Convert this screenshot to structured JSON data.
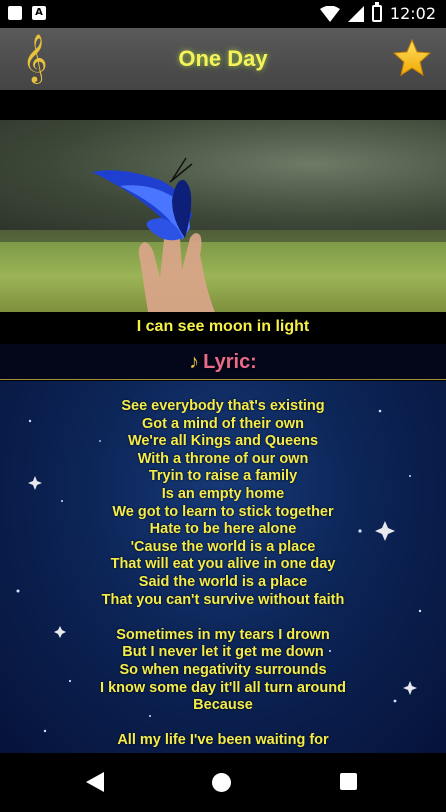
{
  "status_bar": {
    "time": "12:02",
    "left_icons": [
      "sd-card-icon",
      "notification-a-icon"
    ],
    "right_icons": [
      "wifi-icon",
      "signal-icon",
      "battery-icon"
    ]
  },
  "app_bar": {
    "title": "One Day",
    "left_icon": "treble-clef-icon",
    "right_icon": "favorite-star-icon",
    "title_color": "#f6f25a",
    "icon_color": "#e8c23a"
  },
  "video": {
    "caption": "I can see moon in light"
  },
  "lyric_section": {
    "label": "Lyric:",
    "icon": "music-note-icon",
    "label_color": "#e96a8b",
    "text_color": "#f4ec4c",
    "lines": [
      "See everybody that's existing",
      "Got a mind of their own",
      "We're all Kings and Queens",
      "With a throne of our own",
      "Tryin to raise a family",
      "Is an empty home",
      "We got to learn to stick together",
      "Hate to be here alone",
      "'Cause the world is a place",
      "That will eat you alive in one day",
      "Said the world is a place",
      "That you can't survive without faith",
      "",
      "Sometimes in my tears I drown",
      "But I never let it get me down",
      "So when negativity surrounds",
      "I know some day it'll all turn around",
      "Because",
      "",
      "All my life I've been waiting for"
    ]
  },
  "nav_bar": {
    "buttons": [
      "back-icon",
      "home-icon",
      "recent-apps-icon"
    ]
  }
}
